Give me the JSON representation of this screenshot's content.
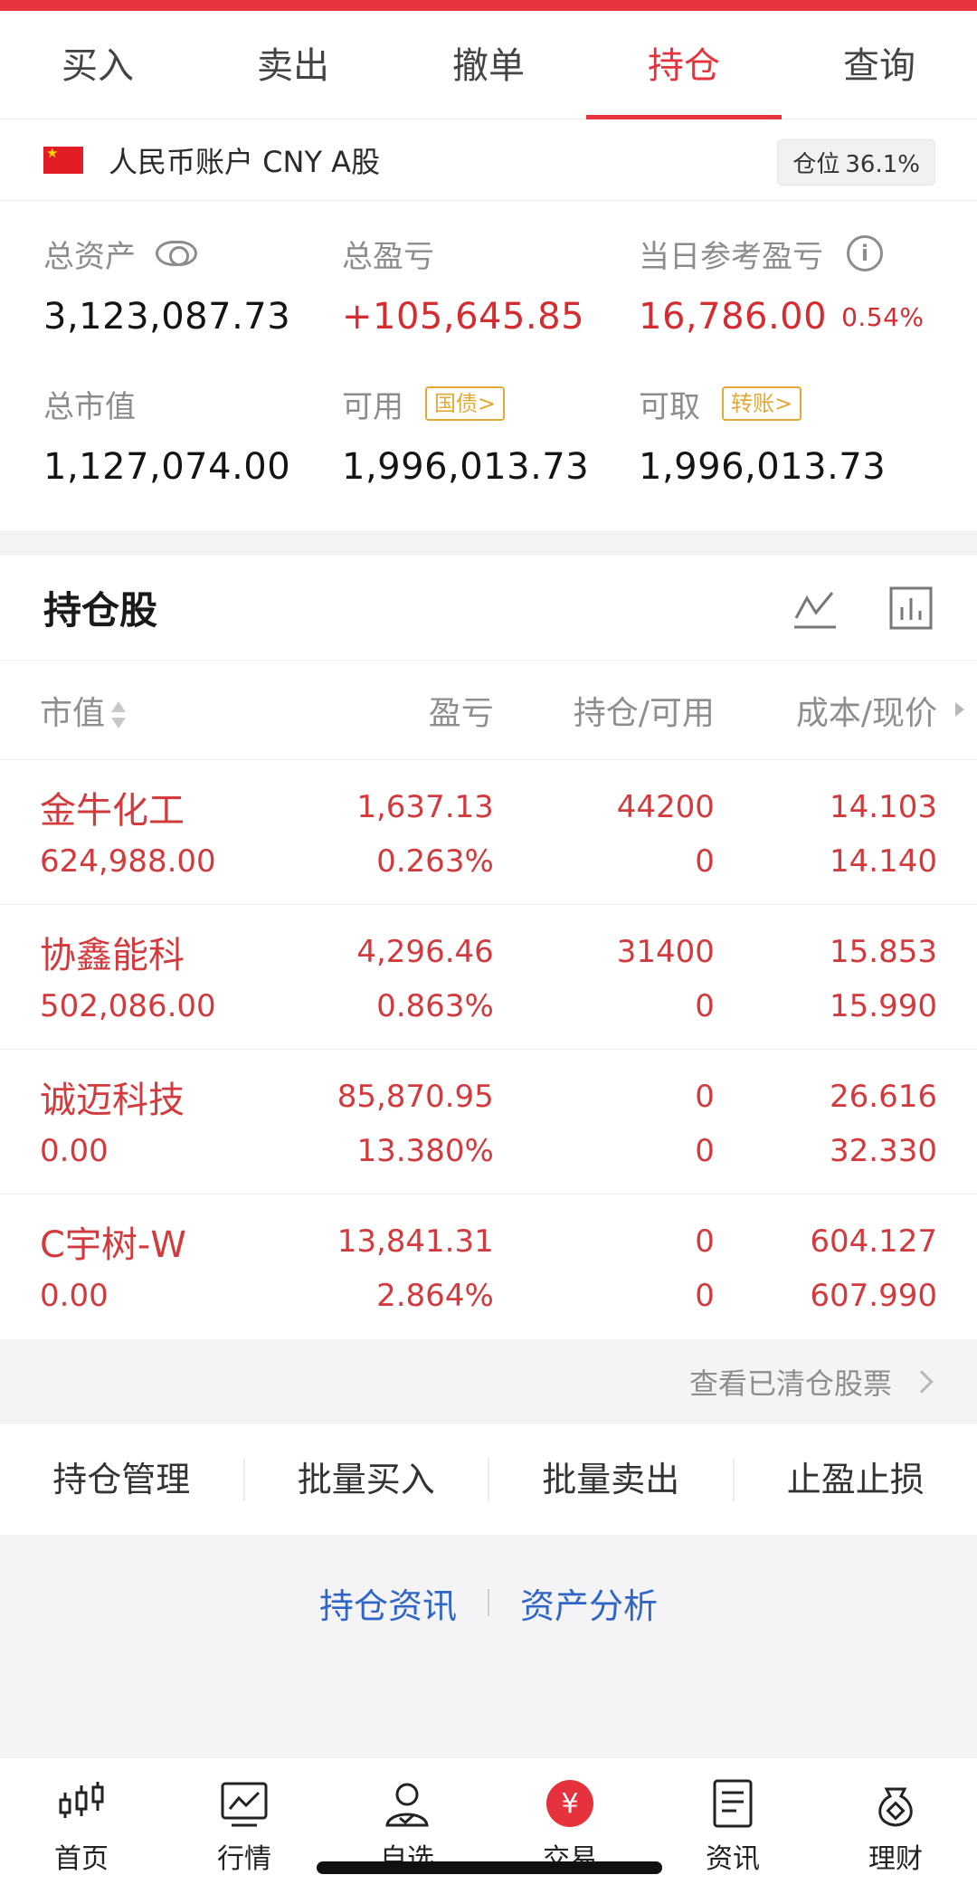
{
  "tabs": [
    "买入",
    "卖出",
    "撤单",
    "持仓",
    "查询"
  ],
  "active_tab": "持仓",
  "account": {
    "name": "人民币账户 CNY A股",
    "position_label": "仓位",
    "position_value": "36.1%"
  },
  "summary": {
    "total_assets_label": "总资产",
    "total_assets_value": "3,123,087.73",
    "total_pl_label": "总盈亏",
    "total_pl_value": "+105,645.85",
    "daily_pl_label": "当日参考盈亏",
    "daily_pl_value": "16,786.00",
    "daily_pl_pct": "0.54%",
    "market_value_label": "总市值",
    "market_value_value": "1,127,074.00",
    "available_label": "可用",
    "available_tag": "国债>",
    "available_value": "1,996,013.73",
    "withdrawable_label": "可取",
    "withdrawable_tag": "转账>",
    "withdrawable_value": "1,996,013.73"
  },
  "holdings": {
    "title": "持仓股",
    "columns": [
      "市值",
      "盈亏",
      "持仓/可用",
      "成本/现价"
    ],
    "rows": [
      {
        "name": "金牛化工",
        "market_value": "624,988.00",
        "pl": "1,637.13",
        "pl_pct": "0.263%",
        "position": "44200",
        "available": "0",
        "cost": "14.103",
        "price": "14.140"
      },
      {
        "name": "协鑫能科",
        "market_value": "502,086.00",
        "pl": "4,296.46",
        "pl_pct": "0.863%",
        "position": "31400",
        "available": "0",
        "cost": "15.853",
        "price": "15.990"
      },
      {
        "name": "诚迈科技",
        "market_value": "0.00",
        "pl": "85,870.95",
        "pl_pct": "13.380%",
        "position": "0",
        "available": "0",
        "cost": "26.616",
        "price": "32.330"
      },
      {
        "name": "C宇树-W",
        "market_value": "0.00",
        "pl": "13,841.31",
        "pl_pct": "2.864%",
        "position": "0",
        "available": "0",
        "cost": "604.127",
        "price": "607.990"
      }
    ],
    "cleared_link": "查看已清仓股票"
  },
  "actions": [
    "持仓管理",
    "批量买入",
    "批量卖出",
    "止盈止损"
  ],
  "links": [
    "持仓资讯",
    "资产分析"
  ],
  "nav": [
    "首页",
    "行情",
    "自选",
    "交易",
    "资讯",
    "理财"
  ],
  "colors": {
    "accent": "#e5323c",
    "profit": "#d33a3d",
    "link": "#2f65c7",
    "tag": "#e3a935"
  }
}
